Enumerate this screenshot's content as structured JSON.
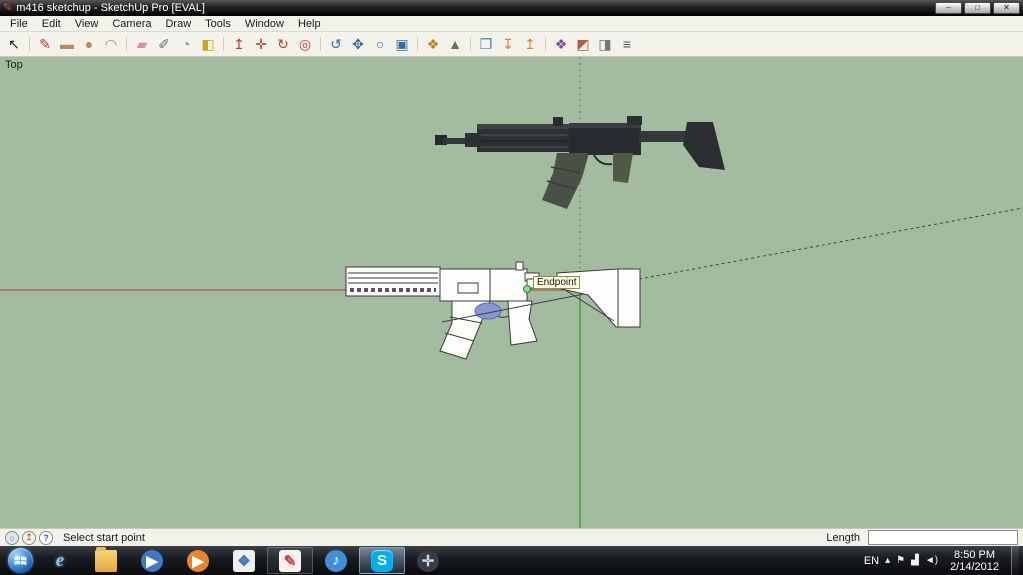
{
  "titlebar": {
    "title": "m416 sketchup - SketchUp Pro [EVAL]",
    "app_icon_glyph": "✎",
    "buttons": [
      {
        "name": "minimize-button",
        "glyph": "‒"
      },
      {
        "name": "maximize-button",
        "glyph": "□"
      },
      {
        "name": "close-button",
        "glyph": "✕"
      }
    ]
  },
  "menubar": {
    "items": [
      {
        "label": "File"
      },
      {
        "label": "Edit"
      },
      {
        "label": "View"
      },
      {
        "label": "Camera"
      },
      {
        "label": "Draw"
      },
      {
        "label": "Tools"
      },
      {
        "label": "Window"
      },
      {
        "label": "Help"
      }
    ]
  },
  "toolbar": {
    "buttons": [
      {
        "name": "select-tool",
        "glyph": "↖",
        "color": "#1b1b1b",
        "cls": ""
      },
      {
        "name": "line-tool",
        "glyph": "✎",
        "color": "#c0392b",
        "cls": "sep"
      },
      {
        "name": "rectangle-tool",
        "glyph": "▬",
        "color": "#b98a5a",
        "cls": ""
      },
      {
        "name": "circle-tool",
        "glyph": "●",
        "color": "#b98a5a",
        "cls": ""
      },
      {
        "name": "arc-tool",
        "glyph": "◠",
        "color": "#b98a5a",
        "cls": ""
      },
      {
        "name": "eraser-tool",
        "glyph": "▰",
        "color": "#d98fa5",
        "cls": "sep"
      },
      {
        "name": "tape-measure-tool",
        "glyph": "✐",
        "color": "#6f6f6f",
        "cls": ""
      },
      {
        "name": "protractor-tool",
        "glyph": "◔",
        "color": "#7d8fb5",
        "cls": ""
      },
      {
        "name": "paint-bucket-tool",
        "glyph": "◧",
        "color": "#c9a227",
        "cls": ""
      },
      {
        "name": "push-pull-tool",
        "glyph": "↥",
        "color": "#c0392b",
        "cls": "sep"
      },
      {
        "name": "move-tool",
        "glyph": "✛",
        "color": "#c0392b",
        "cls": ""
      },
      {
        "name": "rotate-tool",
        "glyph": "↻",
        "color": "#c0392b",
        "cls": ""
      },
      {
        "name": "offset-tool",
        "glyph": "◎",
        "color": "#c0392b",
        "cls": ""
      },
      {
        "name": "orbit-tool",
        "glyph": "↺",
        "color": "#2e6da4",
        "cls": "sep"
      },
      {
        "name": "pan-tool",
        "glyph": "✥",
        "color": "#2e6da4",
        "cls": ""
      },
      {
        "name": "zoom-tool",
        "glyph": "○",
        "color": "#2e6da4",
        "cls": ""
      },
      {
        "name": "zoom-extents-tool",
        "glyph": "▣",
        "color": "#2e6da4",
        "cls": ""
      },
      {
        "name": "add-location-tool",
        "glyph": "❖",
        "color": "#b8860b",
        "cls": "sep"
      },
      {
        "name": "toggle-terrain-tool",
        "glyph": "▲",
        "color": "#5a7a4a",
        "cls": ""
      },
      {
        "name": "photo-textures-tool",
        "glyph": "❐",
        "color": "#4a7ab5",
        "cls": "sep"
      },
      {
        "name": "get-models-tool",
        "glyph": "↧",
        "color": "#d9822b",
        "cls": ""
      },
      {
        "name": "share-models-tool",
        "glyph": "↥",
        "color": "#d9822b",
        "cls": ""
      },
      {
        "name": "components-tool",
        "glyph": "❖",
        "color": "#7a4a9a",
        "cls": "sep"
      },
      {
        "name": "materials-tool",
        "glyph": "◩",
        "color": "#b55a3a",
        "cls": ""
      },
      {
        "name": "styles-tool",
        "glyph": "◨",
        "color": "#777777",
        "cls": ""
      },
      {
        "name": "layers-tool",
        "glyph": "≡",
        "color": "#555555",
        "cls": ""
      }
    ]
  },
  "canvas": {
    "view_label": "Top",
    "endpoint_tooltip": "Endpoint",
    "colors": {
      "background": "#a3bc9f",
      "axis_red": "#b5524a",
      "axis_green": "#3b9c3b",
      "inference_line": "#3a3a55",
      "endpoint_marker": "#86e186",
      "selected_face_blue": "#8b97d0"
    }
  },
  "statusbar": {
    "icons": [
      {
        "name": "geolocation-icon",
        "glyph": "○",
        "fg": "#3a6ea5",
        "bg": "#dfe6ee"
      },
      {
        "name": "credits-icon",
        "glyph": "↥",
        "fg": "#c07a2a",
        "bg": "#f7f7f2"
      },
      {
        "name": "help-icon",
        "glyph": "?",
        "fg": "#2a5fcc",
        "bg": "#ffffff"
      }
    ],
    "message": "Select start point",
    "length_label": "Length",
    "length_value": ""
  },
  "taskbar": {
    "apps": [
      {
        "name": "internet-explorer-icon",
        "glyph": "e",
        "fg": "#7fc4f2",
        "bg": "transparent",
        "cls": "",
        "tileCls": "ie-style"
      },
      {
        "name": "windows-explorer-icon",
        "glyph": "",
        "fg": "#7a5c1e",
        "bg": "",
        "cls": "",
        "tileCls": "folder"
      },
      {
        "name": "media-player-icon",
        "glyph": "▶",
        "fg": "#ffffff",
        "bg": "#3f77c2",
        "cls": "",
        "tileCls": "round"
      },
      {
        "name": "media-app-icon",
        "glyph": "▶",
        "fg": "#ffffff",
        "bg": "#e8842c",
        "cls": "",
        "tileCls": "round"
      },
      {
        "name": "photo-viewer-icon",
        "glyph": "❖",
        "fg": "#3f77c2",
        "bg": "#f0f0f0",
        "cls": "",
        "tileCls": ""
      },
      {
        "name": "sketchup-icon",
        "glyph": "✎",
        "fg": "#d23b2f",
        "bg": "#f5f3ee",
        "cls": "open",
        "tileCls": ""
      },
      {
        "name": "itunes-icon",
        "glyph": "♪",
        "fg": "#ffffff",
        "bg": "#3f8fd6",
        "cls": "",
        "tileCls": "round"
      },
      {
        "name": "skype-icon",
        "glyph": "S",
        "fg": "#ffffff",
        "bg": "#00aff0",
        "cls": "open active",
        "tileCls": "squircle"
      },
      {
        "name": "navigator-icon",
        "glyph": "✛",
        "fg": "#d0d8e0",
        "bg": "#343c46",
        "cls": "",
        "tileCls": "round"
      }
    ],
    "tray": {
      "language": "EN",
      "icons": [
        {
          "name": "hidden-icons-icon",
          "glyph": "▴"
        },
        {
          "name": "action-center-flag-icon",
          "glyph": "⚑"
        },
        {
          "name": "network-icon",
          "glyph": "▟"
        },
        {
          "name": "volume-icon",
          "glyph": "◄)"
        }
      ],
      "time": "8:50 PM",
      "date": "2/14/2012"
    }
  }
}
